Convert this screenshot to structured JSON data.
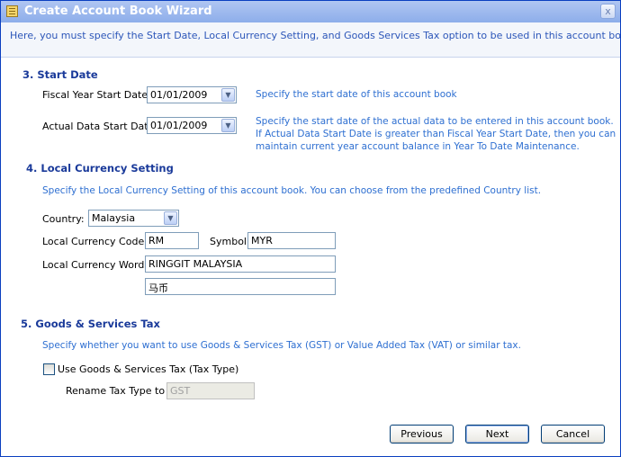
{
  "window": {
    "title": "Create Account Book Wizard",
    "close_glyph": "x",
    "icon": "book-icon"
  },
  "info": "Here, you must specify the Start Date, Local Currency Setting, and Goods  Services Tax option to be used in this account book.",
  "start_date": {
    "heading": "3. Start Date",
    "fiscal_label": "Fiscal Year Start Date:",
    "fiscal_value": "01/01/2009",
    "fiscal_desc": "Specify the start date of this account book",
    "actual_label": "Actual Data Start Date:",
    "actual_value": "01/01/2009",
    "actual_desc": [
      "Specify the start date of the actual data to be entered in this account book.",
      "If Actual Data Start Date is greater than Fiscal Year Start Date, then you can",
      "maintain current year account balance in Year To Date Maintenance."
    ]
  },
  "currency": {
    "heading": "4. Local Currency Setting",
    "desc": "Specify the Local Currency Setting of this account book. You can choose from the predefined Country list.",
    "country_label": "Country:",
    "country_value": "Malaysia",
    "code_label": "Local Currency Code:",
    "code_value": "RM",
    "symbol_label": "Symbol:",
    "symbol_value": "MYR",
    "word_label": "Local Currency Word:",
    "word_value": "RINGGIT MALAYSIA",
    "word_value_2": "马币"
  },
  "gst": {
    "heading": "5. Goods & Services Tax",
    "desc": "Specify whether you want to use Goods & Services Tax (GST) or Value Added Tax (VAT) or similar tax.",
    "checkbox_label": "Use Goods & Services Tax (Tax Type)",
    "checked": false,
    "rename_label": "Rename Tax Type to",
    "rename_placeholder": "GST"
  },
  "buttons": {
    "previous": "Previous",
    "next": "Next",
    "cancel": "Cancel"
  },
  "colors": {
    "titlebar": "#8daeea",
    "heading": "#1a3a9a",
    "description": "#2e6fd1"
  }
}
